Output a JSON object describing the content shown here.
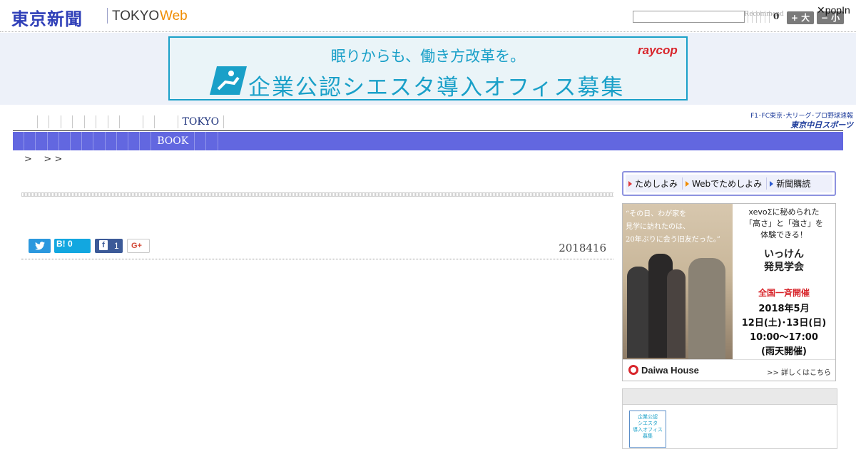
{
  "header": {
    "logo_jp": "東京新聞",
    "logo_tokyo": "TOKYO",
    "logo_web": "Web",
    "search_value": "",
    "recommend": "Recommend",
    "count": "0",
    "font_bigger": "+ 大",
    "font_smaller": "− 小",
    "popin": "popIn"
  },
  "top_ad": {
    "line1": "眠りからも、働き方改革を。",
    "line2": "企業公認シエスタ導入オフィス募集",
    "brand": "raycop"
  },
  "nav": {
    "tokyo_label": "TOKYO",
    "chunichi_line1": "F1･FC東京･大リーグ･プロ野球速報",
    "chunichi_line2": "東京中日スポーツ",
    "book_label": "BOOK"
  },
  "breadcrumb": ">    > >",
  "article": {
    "date": "2018416",
    "hatena_label": "B! 0",
    "fb_count": "1",
    "gplus_label": "G+"
  },
  "sidebar": {
    "sub_nav": [
      "ためしよみ",
      "Webでためしよみ",
      "新聞購読"
    ],
    "ad": {
      "copy": "“その日、わが家を\n見学に訪れたのは、\n20年ぶりに会う旧友だった。”",
      "right_line1": "xevoΣに秘められた\n「高さ」と「強さ」を\n体験できる！",
      "right_title": "いっけん\n発見学会",
      "right_event": "全国一斉開催",
      "right_dates": "2018年5月\n12日(土)･13日(日)\n10:00〜17:00\n(雨天開催)",
      "brand": "Daiwa House",
      "more": ">> 詳しくはこちら"
    },
    "box_img_text": "企業公認\nシエスタ\n導入オフィス\n募集"
  },
  "colors": {
    "brand_blue": "#2f3fb8",
    "nav_purple": "#6267e0",
    "web_orange": "#f08c00",
    "ad_cyan": "#1aa0c8"
  }
}
